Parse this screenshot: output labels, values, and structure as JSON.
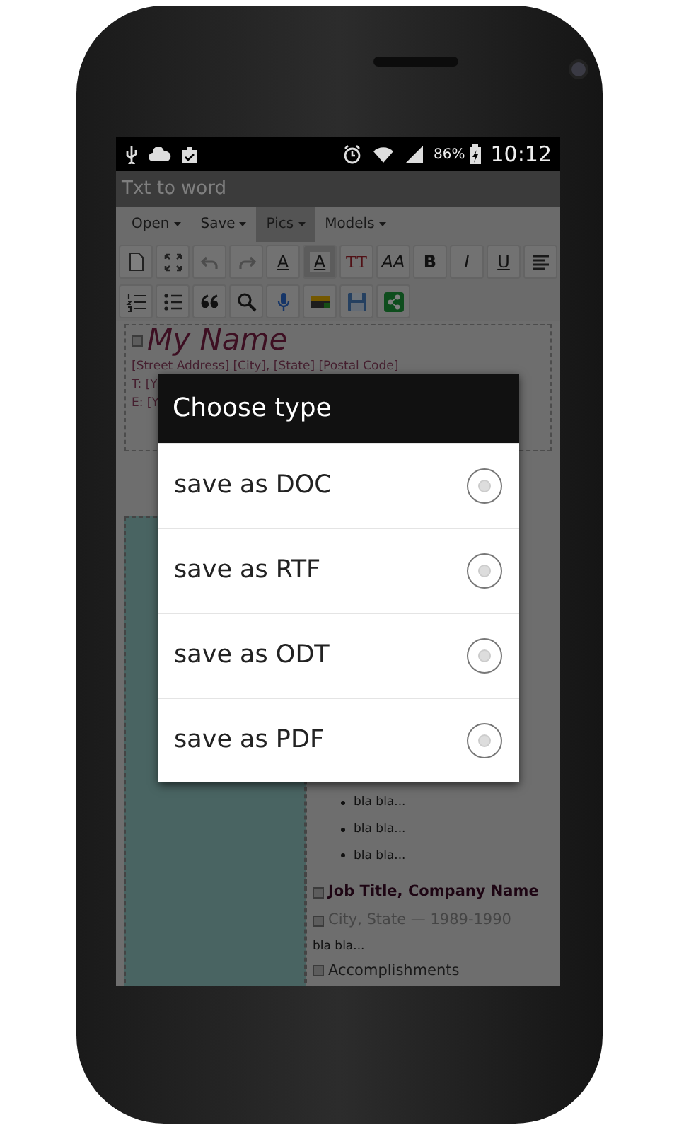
{
  "status_bar": {
    "battery_text": "86%",
    "time": "10:12"
  },
  "action_bar": {
    "title": "Txt to word"
  },
  "menu": [
    {
      "label": "Open",
      "selected": false
    },
    {
      "label": "Save",
      "selected": false
    },
    {
      "label": "Pics",
      "selected": true
    },
    {
      "label": "Models",
      "selected": false
    }
  ],
  "toolbar_rows": [
    [
      {
        "kind": "icon",
        "disabled": false
      },
      {
        "kind": "icon",
        "disabled": false
      },
      {
        "kind": "icon",
        "disabled": true
      },
      {
        "kind": "icon",
        "disabled": true
      },
      {
        "kind": "glyph",
        "glyph": "A"
      },
      {
        "kind": "glyph",
        "glyph": "A"
      },
      {
        "kind": "glyph",
        "glyph": "TT"
      },
      {
        "kind": "glyph",
        "glyph": "AA"
      },
      {
        "kind": "glyph",
        "glyph": "B"
      },
      {
        "kind": "glyph",
        "glyph": "I"
      },
      {
        "kind": "glyph",
        "glyph": "U"
      },
      {
        "kind": "icon",
        "disabled": false
      }
    ],
    [
      {
        "kind": "icon",
        "disabled": false
      },
      {
        "kind": "icon",
        "disabled": false
      },
      {
        "kind": "icon",
        "disabled": false
      },
      {
        "kind": "icon",
        "disabled": false
      },
      {
        "kind": "icon",
        "disabled": false
      },
      {
        "kind": "icon",
        "disabled": false
      },
      {
        "kind": "icon",
        "disabled": false
      },
      {
        "kind": "icon",
        "disabled": false
      }
    ]
  ],
  "document": {
    "name": "My Name",
    "contact_lines": [
      "[Street Address] [City], [State] [Postal Code]",
      "T: [Y",
      "E: [Y"
    ],
    "bullets": [
      "bla bla...",
      "bla bla...",
      "bla bla..."
    ],
    "job_title": "Job Title, Company Name",
    "job_place": "City, State — 1989-1990",
    "job_text": "bla bla...",
    "section": "Accomplishments"
  },
  "dialog": {
    "title": "Choose type",
    "options": [
      {
        "label": "save as DOC",
        "selected": false
      },
      {
        "label": "save as RTF",
        "selected": false
      },
      {
        "label": "save as ODT",
        "selected": false
      },
      {
        "label": "save as PDF",
        "selected": false
      }
    ]
  }
}
